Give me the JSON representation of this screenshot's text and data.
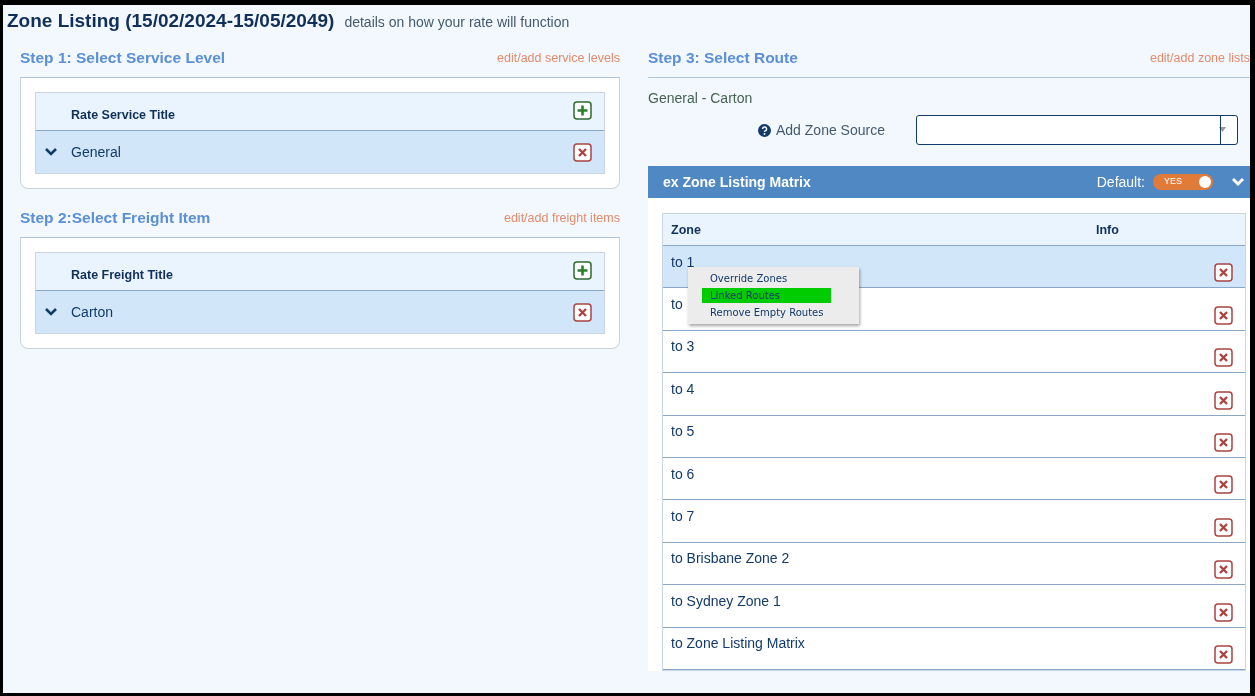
{
  "header": {
    "title": "Zone Listing (15/02/2024-15/05/2049)",
    "subtitle": "details on how your rate will function"
  },
  "steps": [
    {
      "title": "Step 1: Select Service Level",
      "link": "edit/add service levels",
      "column": "Rate Service Title",
      "rows": [
        {
          "label": "General",
          "selected": true
        }
      ]
    },
    {
      "title": "Step 2:Select Freight Item",
      "link": "edit/add freight items",
      "column": "Rate Freight Title",
      "rows": [
        {
          "label": "Carton",
          "selected": true
        }
      ]
    }
  ],
  "route": {
    "title": "Step 3: Select Route",
    "link": "edit/add zone lists",
    "selection": "General - Carton",
    "source_label": "Add Zone Source",
    "matrix": {
      "title": "ex Zone Listing Matrix",
      "default_label": "Default:",
      "toggle": {
        "on": true,
        "label": "YES"
      },
      "columns": [
        "Zone",
        "Info"
      ],
      "rows": [
        {
          "zone": "to 1",
          "selected": true
        },
        {
          "zone": "to",
          "selected": false
        },
        {
          "zone": "to 3",
          "selected": false
        },
        {
          "zone": "to 4",
          "selected": false
        },
        {
          "zone": "to 5",
          "selected": false
        },
        {
          "zone": "to 6",
          "selected": false
        },
        {
          "zone": "to 7",
          "selected": false
        },
        {
          "zone": "to Brisbane Zone 2",
          "selected": false
        },
        {
          "zone": "to Sydney Zone 1",
          "selected": false
        },
        {
          "zone": "to Zone Listing Matrix",
          "selected": false
        }
      ]
    }
  },
  "context_menu": [
    {
      "label": "Override Zones",
      "selected": false
    },
    {
      "label": "Linked Routes",
      "selected": true
    },
    {
      "label": "Remove Empty Routes",
      "selected": false
    }
  ]
}
